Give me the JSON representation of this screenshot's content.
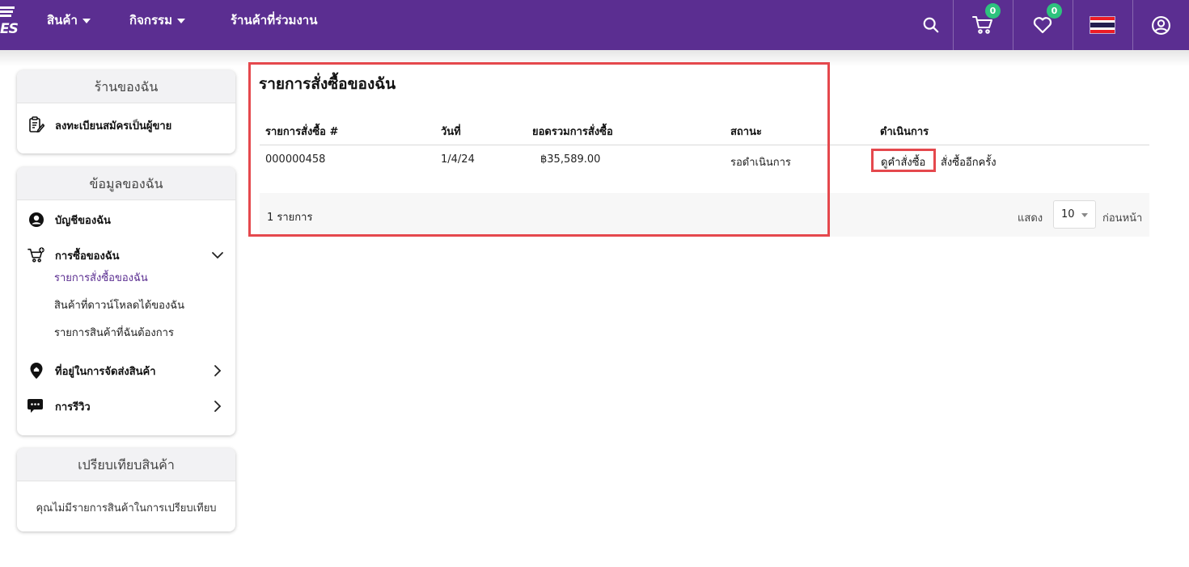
{
  "header": {
    "logo_text": "ES",
    "nav": [
      {
        "label": "สินค้า",
        "has_dropdown": true
      },
      {
        "label": "กิจกรรม",
        "has_dropdown": true
      },
      {
        "label": "ร้านค้าที่ร่วมงาน",
        "has_dropdown": false
      }
    ],
    "icons": [
      "search-icon",
      "cart-icon",
      "heart-icon",
      "thai-flag-icon",
      "user-icon"
    ],
    "cart_count": "0",
    "wishlist_count": "0",
    "flag_colors": [
      "#ed1c24",
      "#ffffff",
      "#241d4f",
      "#ffffff",
      "#ed1c24"
    ]
  },
  "sidebar": {
    "my_store": {
      "title": "ร้านของฉัน",
      "items": [
        {
          "label": "ลงทะเบียนสมัครเป็นผู้ขาย",
          "icon": "register-seller-icon"
        }
      ]
    },
    "my_info": {
      "title": "ข้อมูลของฉัน",
      "items": [
        {
          "label": "บัญชีของฉัน",
          "icon": "account-icon"
        },
        {
          "label": "การซื้อของฉัน",
          "icon": "cart-add-icon",
          "expanded": true
        },
        {
          "label": "ที่อยู่ในการจัดส่งสินค้า",
          "icon": "location-pin-icon"
        },
        {
          "label": "การรีวิว",
          "icon": "review-chat-icon"
        }
      ],
      "purchase_subitems": [
        {
          "label": "รายการสั่งซื้อของฉัน",
          "active": true
        },
        {
          "label": "สินค้าที่ดาวน์โหลดได้ของฉัน"
        },
        {
          "label": "รายการสินค้าที่ฉันต้องการ"
        }
      ]
    },
    "compare": {
      "title": "เปรียบเทียบสินค้า",
      "empty_text": "คุณไม่มีรายการสินค้าในการเปรียบเทียบ"
    }
  },
  "main": {
    "title": "รายการสั่งซื้อของฉัน",
    "columns": [
      "รายการสั่งซื้อ #",
      "วันที่",
      "ยอดรวมการสั่งซื้อ",
      "สถานะ",
      "ดำเนินการ"
    ],
    "orders": [
      {
        "order_no": "000000458",
        "date": "1/4/24",
        "total": "฿35,589.00",
        "status": "รอดำเนินการ",
        "actions": [
          "ดูคำสั่งซื้อ",
          "สั่งซื้ออีกครั้ง"
        ]
      }
    ],
    "footer": {
      "count_text": "1 รายการ",
      "show_label": "แสดง",
      "per_page": "10",
      "per_page_suffix": "ก่อนหน้า"
    }
  },
  "annotation_color": "#e5484d",
  "brand_color": "#5b2e91"
}
